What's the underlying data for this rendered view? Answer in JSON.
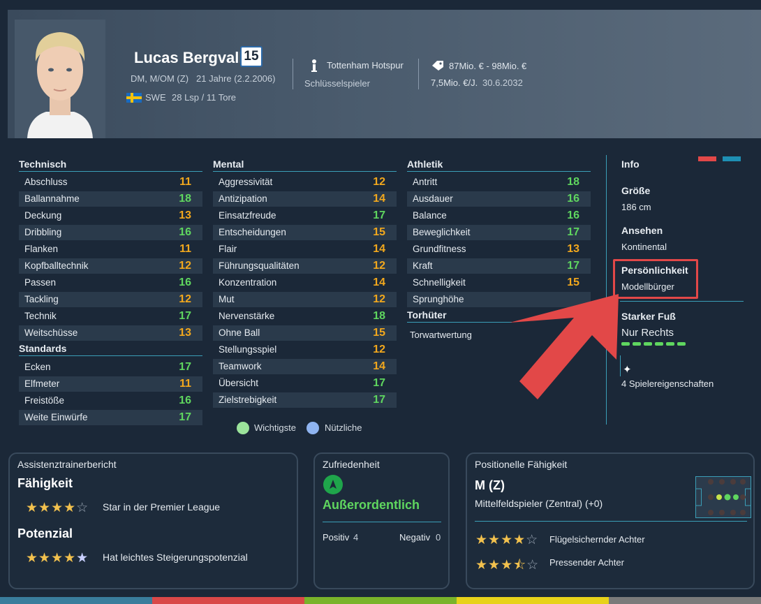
{
  "player": {
    "name": "Lucas Bergvall",
    "shirt_number": "15",
    "positions": "DM, M/OM (Z)",
    "age_birth": "21 Jahre (2.2.2006)",
    "nation": "SWE",
    "caps_goals": "28 Lsp / 11 Tore",
    "club": "Tottenham Hotspur",
    "role": "Schlüsselspieler",
    "value": "87Mio. € - 98Mio. €",
    "wage": "7,5Mio. €/J.",
    "contract_end": "30.6.2032"
  },
  "technical": {
    "title": "Technisch",
    "rows": [
      {
        "label": "Abschluss",
        "value": "11"
      },
      {
        "label": "Ballannahme",
        "value": "18"
      },
      {
        "label": "Deckung",
        "value": "13"
      },
      {
        "label": "Dribbling",
        "value": "16"
      },
      {
        "label": "Flanken",
        "value": "11"
      },
      {
        "label": "Kopfballtechnik",
        "value": "12"
      },
      {
        "label": "Passen",
        "value": "16"
      },
      {
        "label": "Tackling",
        "value": "12"
      },
      {
        "label": "Technik",
        "value": "17"
      },
      {
        "label": "Weitschüsse",
        "value": "13"
      }
    ]
  },
  "setpieces": {
    "title": "Standards",
    "rows": [
      {
        "label": "Ecken",
        "value": "17"
      },
      {
        "label": "Elfmeter",
        "value": "11"
      },
      {
        "label": "Freistöße",
        "value": "16"
      },
      {
        "label": "Weite Einwürfe",
        "value": "17"
      }
    ]
  },
  "mental": {
    "title": "Mental",
    "rows": [
      {
        "label": "Aggressivität",
        "value": "12"
      },
      {
        "label": "Antizipation",
        "value": "14"
      },
      {
        "label": "Einsatzfreude",
        "value": "17"
      },
      {
        "label": "Entscheidungen",
        "value": "15"
      },
      {
        "label": "Flair",
        "value": "14"
      },
      {
        "label": "Führungsqualitäten",
        "value": "12"
      },
      {
        "label": "Konzentration",
        "value": "14"
      },
      {
        "label": "Mut",
        "value": "12"
      },
      {
        "label": "Nervenstärke",
        "value": "18"
      },
      {
        "label": "Ohne Ball",
        "value": "15"
      },
      {
        "label": "Stellungsspiel",
        "value": "12"
      },
      {
        "label": "Teamwork",
        "value": "14"
      },
      {
        "label": "Übersicht",
        "value": "17"
      },
      {
        "label": "Zielstrebigkeit",
        "value": "17"
      }
    ]
  },
  "physical": {
    "title": "Athletik",
    "rows": [
      {
        "label": "Antritt",
        "value": "18"
      },
      {
        "label": "Ausdauer",
        "value": "16"
      },
      {
        "label": "Balance",
        "value": "16"
      },
      {
        "label": "Beweglichkeit",
        "value": "17"
      },
      {
        "label": "Grundfitness",
        "value": "13"
      },
      {
        "label": "Kraft",
        "value": "17"
      },
      {
        "label": "Schnelligkeit",
        "value": "15"
      },
      {
        "label": "Sprunghöhe",
        "value": ""
      }
    ]
  },
  "goalkeeper": {
    "title": "Torhüter",
    "rating_label": "Torwartwertung"
  },
  "legend": {
    "key": "Wichtigste",
    "useful": "Nützliche",
    "key_color": "#9be39b",
    "useful_color": "#8fb4f0"
  },
  "info": {
    "title": "Info",
    "height_label": "Größe",
    "height_value": "186 cm",
    "reputation_label": "Ansehen",
    "reputation_value": "Kontinental",
    "personality_label": "Persönlichkeit",
    "personality_value": "Modellbürger",
    "foot_label": "Starker Fuß",
    "foot_value": "Nur Rechts",
    "traits": "4 Spielereigenschaften"
  },
  "coach_report": {
    "title": "Assistenztrainerbericht",
    "ability_label": "Fähigkeit",
    "ability_stars": 4,
    "ability_text": "Star in der Premier League",
    "potential_label": "Potenzial",
    "potential_stars": 4.5,
    "potential_text": "Hat leichtes Steigerungspotenzial"
  },
  "happiness": {
    "title": "Zufriedenheit",
    "status": "Außerordentlich",
    "positive_label": "Positiv",
    "positive_count": "4",
    "negative_label": "Negativ",
    "negative_count": "0"
  },
  "positional": {
    "title": "Positionelle Fähigkeit",
    "position": "M (Z)",
    "position_desc": "Mittelfeldspieler (Zentral) (+0)",
    "roles": [
      {
        "stars": 4,
        "name": "Flügelsichernder Achter"
      },
      {
        "stars": 3.5,
        "name": "Pressender Achter"
      }
    ]
  },
  "colors": {
    "accent": "#3b9fb8",
    "green": "#5fd65f",
    "orange": "#f2a81d",
    "highlight_red": "#e24848"
  }
}
